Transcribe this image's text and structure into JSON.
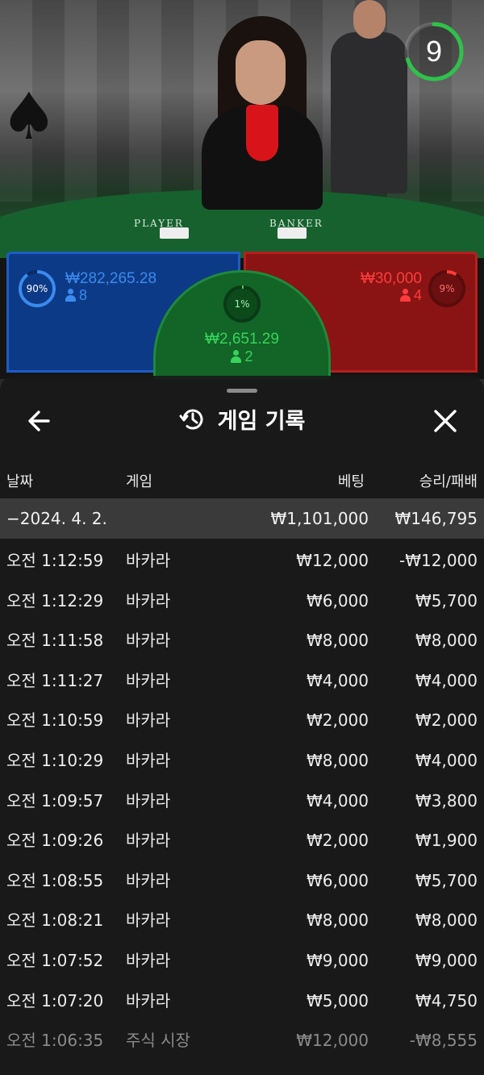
{
  "video": {
    "timer": "9",
    "felt_player_label": "PLAYER",
    "felt_banker_label": "BANKER"
  },
  "bets": {
    "player": {
      "percent": "90%",
      "amount": "₩282,265.28",
      "count": "8",
      "color": "#1d5cc8"
    },
    "tie": {
      "percent": "1%",
      "amount": "₩2,651.29",
      "count": "2",
      "color": "#1e8a3a"
    },
    "banker": {
      "percent": "9%",
      "amount": "₩30,000",
      "count": "4",
      "color": "#b51f1f"
    }
  },
  "history": {
    "title": "게임 기록",
    "icons": {
      "back": "arrow-left-icon",
      "title": "history-clock-icon",
      "close": "close-icon"
    },
    "columns": {
      "date": "날짜",
      "game": "게임",
      "bet": "베팅",
      "result": "승리/패배"
    },
    "summary": {
      "date": "−2024. 4. 2.",
      "bet": "₩1,101,000",
      "result": "₩146,795"
    },
    "rows": [
      {
        "time": "오전 1:12:59",
        "game": "바카라",
        "bet": "₩12,000",
        "result": "-₩12,000"
      },
      {
        "time": "오전 1:12:29",
        "game": "바카라",
        "bet": "₩6,000",
        "result": "₩5,700"
      },
      {
        "time": "오전 1:11:58",
        "game": "바카라",
        "bet": "₩8,000",
        "result": "₩8,000"
      },
      {
        "time": "오전 1:11:27",
        "game": "바카라",
        "bet": "₩4,000",
        "result": "₩4,000"
      },
      {
        "time": "오전 1:10:59",
        "game": "바카라",
        "bet": "₩2,000",
        "result": "₩2,000"
      },
      {
        "time": "오전 1:10:29",
        "game": "바카라",
        "bet": "₩8,000",
        "result": "₩4,000"
      },
      {
        "time": "오전 1:09:57",
        "game": "바카라",
        "bet": "₩4,000",
        "result": "₩3,800"
      },
      {
        "time": "오전 1:09:26",
        "game": "바카라",
        "bet": "₩2,000",
        "result": "₩1,900"
      },
      {
        "time": "오전 1:08:55",
        "game": "바카라",
        "bet": "₩6,000",
        "result": "₩5,700"
      },
      {
        "time": "오전 1:08:21",
        "game": "바카라",
        "bet": "₩8,000",
        "result": "₩8,000"
      },
      {
        "time": "오전 1:07:52",
        "game": "바카라",
        "bet": "₩9,000",
        "result": "₩9,000"
      },
      {
        "time": "오전 1:07:20",
        "game": "바카라",
        "bet": "₩5,000",
        "result": "₩4,750"
      },
      {
        "time": "오전 1:06:35",
        "game": "주식 시장",
        "bet": "₩12,000",
        "result": "-₩8,555"
      }
    ]
  }
}
